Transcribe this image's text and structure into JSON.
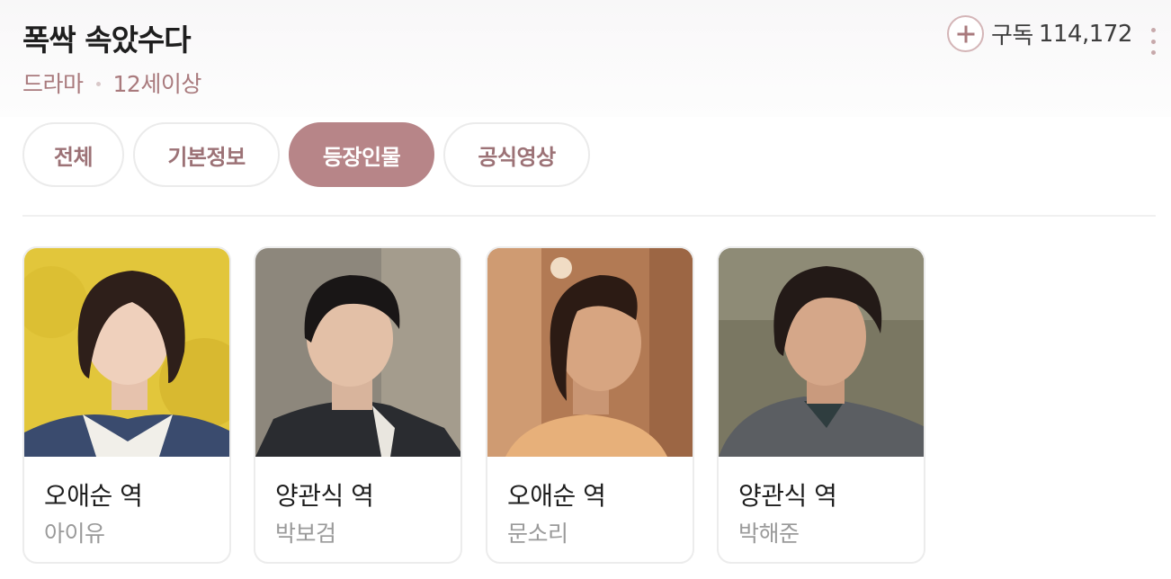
{
  "header": {
    "title": "폭싹 속았수다",
    "genre": "드라마",
    "rating": "12세이상",
    "subscribe_label": "구독",
    "subscribe_count": "114,172"
  },
  "tabs": [
    {
      "label": "전체",
      "active": false
    },
    {
      "label": "기본정보",
      "active": false
    },
    {
      "label": "등장인물",
      "active": true
    },
    {
      "label": "공식영상",
      "active": false
    }
  ],
  "cast": [
    {
      "role": "오애순 역",
      "actor": "아이유"
    },
    {
      "role": "양관식 역",
      "actor": "박보검"
    },
    {
      "role": "오애순 역",
      "actor": "문소리"
    },
    {
      "role": "양관식 역",
      "actor": "박해준"
    }
  ],
  "colors": {
    "accent": "#b78588",
    "meta_text": "#a97a7d",
    "tab_text": "#9c7276"
  }
}
